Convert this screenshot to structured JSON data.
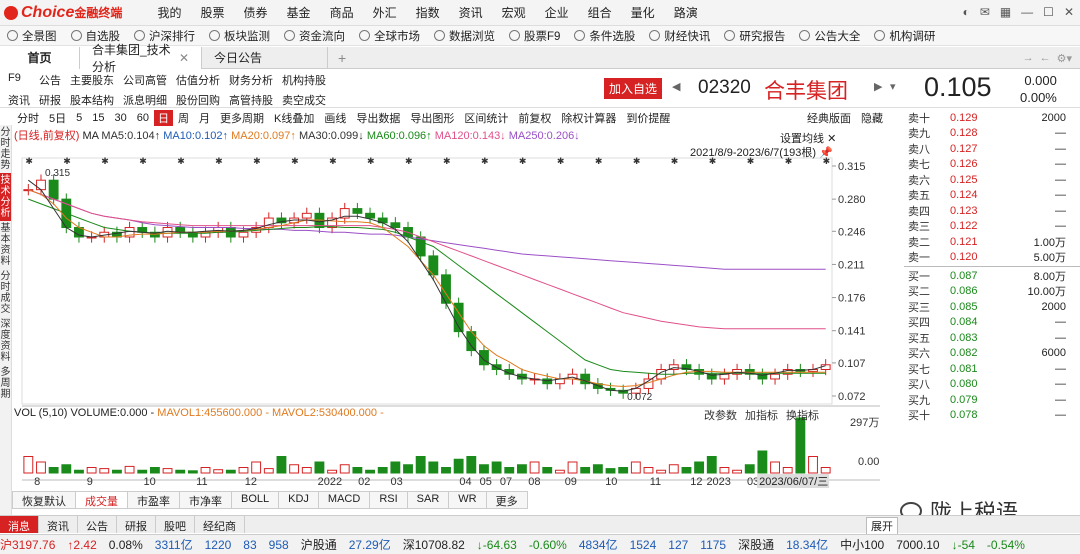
{
  "app": {
    "brand": "Choice",
    "brand_sub": "金融终端"
  },
  "menu": [
    "我的",
    "股票",
    "债券",
    "基金",
    "商品",
    "外汇",
    "指数",
    "资讯",
    "宏观",
    "企业",
    "组合",
    "量化",
    "路演"
  ],
  "toolbar": [
    "全景图",
    "自选股",
    "沪深排行",
    "板块监测",
    "资金流向",
    "全球市场",
    "数据浏览",
    "股票F9",
    "条件选股",
    "财经快讯",
    "研究报告",
    "公告大全",
    "机构调研"
  ],
  "tabs": {
    "home": "首页",
    "current": "合丰集团_技术分析",
    "other": "今日公告"
  },
  "funcs": [
    "F9",
    "公告",
    "主要股东",
    "公司高管",
    "估值分析",
    "财务分析",
    "机构持股",
    "资讯",
    "研报",
    "股本结构",
    "派息明细",
    "股份回购",
    "高管持股",
    "卖空成交"
  ],
  "stock": {
    "add_fav": "加入自选",
    "code": "02320",
    "name": "合丰集团",
    "price": "0.105",
    "change": "0.000",
    "change_pct": "0.00%"
  },
  "leftbar": [
    "分时走势",
    "技术分析",
    "基本资料",
    "分时成交",
    "深度资料",
    "多周期"
  ],
  "kbar": {
    "items": [
      "分时",
      "5日",
      "5",
      "15",
      "30",
      "60",
      "日",
      "周",
      "月",
      "更多周期",
      "K线叠加",
      "画线",
      "导出数据",
      "导出图形",
      "区间统计",
      "前复权",
      "除权计算器",
      "到价提醒"
    ],
    "active": "日",
    "right": [
      "经典版面",
      "隐藏"
    ]
  },
  "legend": {
    "mode": "(日线,前复权)",
    "ma5": "MA5:0.104↑",
    "ma10": "MA10:0.102↑",
    "ma20": "MA20:0.097↑",
    "ma30": "MA30:0.099↓",
    "ma60": "MA60:0.096↑",
    "ma120": "MA120:0.143↓",
    "ma250": "MA250:0.206↓"
  },
  "topright": {
    "setting": "设置均线",
    "range": "2021/8/9-2023/6/7(193根)"
  },
  "vol": {
    "legend": "VOL (5,10) VOLUME:0.000 -",
    "mavol1": "MAVOL1:455600.000 -",
    "mavol2": "MAVOL2:530400.000 -",
    "right": [
      "改参数",
      "加指标",
      "换指标"
    ]
  },
  "bottomtabs": [
    "恢复默认",
    "成交量",
    "市盈率",
    "市净率",
    "BOLL",
    "KDJ",
    "MACD",
    "RSI",
    "SAR",
    "WR",
    "更多"
  ],
  "bottom_active": "成交量",
  "infotabs": [
    "消息",
    "资讯",
    "公告",
    "研报",
    "股吧",
    "经纪商"
  ],
  "expand": "展开",
  "status": [
    "沪3197.76",
    "↑2.42",
    "0.08%",
    "3311亿",
    "1220",
    "83",
    "958",
    "沪股通",
    "27.29亿",
    "深10708.82",
    "↓-64.63",
    "-0.60%",
    "4834亿",
    "1524",
    "127",
    "1175",
    "深股通",
    "18.34亿",
    "中小100",
    "7000.10",
    "↓-54",
    "-0.54%"
  ],
  "orderbook": {
    "sell": [
      [
        "卖十",
        "0.129",
        "2000"
      ],
      [
        "卖九",
        "0.128",
        "—"
      ],
      [
        "卖八",
        "0.127",
        "—"
      ],
      [
        "卖七",
        "0.126",
        "—"
      ],
      [
        "卖六",
        "0.125",
        "—"
      ],
      [
        "卖五",
        "0.124",
        "—"
      ],
      [
        "卖四",
        "0.123",
        "—"
      ],
      [
        "卖三",
        "0.122",
        "—"
      ],
      [
        "卖二",
        "0.121",
        "1.00万"
      ],
      [
        "卖一",
        "0.120",
        "5.00万"
      ]
    ],
    "buy": [
      [
        "买一",
        "0.087",
        "8.00万"
      ],
      [
        "买二",
        "0.086",
        "10.00万"
      ],
      [
        "买三",
        "0.085",
        "2000"
      ],
      [
        "买四",
        "0.084",
        "—"
      ],
      [
        "买五",
        "0.083",
        "—"
      ],
      [
        "买六",
        "0.082",
        "6000"
      ],
      [
        "买七",
        "0.081",
        "—"
      ],
      [
        "买八",
        "0.080",
        "—"
      ],
      [
        "买九",
        "0.079",
        "—"
      ],
      [
        "买十",
        "0.078",
        "—"
      ]
    ]
  },
  "watermark": "陇上税语",
  "chart_data": {
    "type": "candlestick",
    "yticks": [
      "0.315",
      "0.280",
      "0.246",
      "0.211",
      "0.176",
      "0.141",
      "0.107",
      "0.072"
    ],
    "ymin": 0.072,
    "ymax": 0.315,
    "xticks": [
      "8",
      "9",
      "10",
      "11",
      "12",
      "2022",
      "02",
      "03",
      "04",
      "05",
      "07",
      "08",
      "09",
      "10",
      "11",
      "12",
      "2023",
      "03",
      "2023/06/07/三"
    ],
    "annotations": {
      "high": "0.315",
      "low": "0.072"
    },
    "volume_ticks": [
      "297万",
      "0.00"
    ],
    "close": [
      0.29,
      0.3,
      0.28,
      0.25,
      0.24,
      0.24,
      0.245,
      0.24,
      0.25,
      0.245,
      0.24,
      0.25,
      0.245,
      0.24,
      0.245,
      0.25,
      0.24,
      0.245,
      0.25,
      0.26,
      0.255,
      0.26,
      0.265,
      0.25,
      0.26,
      0.27,
      0.265,
      0.26,
      0.255,
      0.25,
      0.24,
      0.22,
      0.2,
      0.17,
      0.14,
      0.12,
      0.105,
      0.1,
      0.095,
      0.09,
      0.09,
      0.085,
      0.09,
      0.095,
      0.085,
      0.08,
      0.078,
      0.075,
      0.08,
      0.09,
      0.1,
      0.105,
      0.1,
      0.095,
      0.09,
      0.095,
      0.1,
      0.095,
      0.09,
      0.095,
      0.1,
      0.098,
      0.1,
      0.105
    ],
    "ma250": [
      0.29,
      0.285,
      0.28,
      0.275,
      0.27,
      0.265,
      0.262,
      0.26,
      0.258,
      0.255,
      0.253,
      0.252,
      0.251,
      0.25,
      0.25,
      0.25,
      0.25,
      0.249,
      0.249,
      0.248,
      0.248,
      0.247,
      0.247,
      0.246,
      0.245,
      0.245,
      0.244,
      0.243,
      0.243,
      0.242,
      0.24,
      0.238,
      0.236,
      0.234,
      0.232,
      0.23,
      0.228,
      0.226,
      0.224,
      0.222,
      0.221,
      0.22,
      0.219,
      0.218,
      0.217,
      0.216,
      0.215,
      0.214,
      0.213,
      0.212,
      0.211,
      0.21,
      0.209,
      0.208,
      0.207,
      0.206,
      0.206,
      0.206,
      0.206,
      0.206,
      0.206,
      0.206,
      0.206,
      0.206
    ],
    "ma120": [
      0.29,
      0.285,
      0.28,
      0.275,
      0.27,
      0.265,
      0.262,
      0.26,
      0.258,
      0.256,
      0.255,
      0.254,
      0.253,
      0.252,
      0.252,
      0.252,
      0.252,
      0.252,
      0.252,
      0.252,
      0.252,
      0.252,
      0.252,
      0.252,
      0.252,
      0.252,
      0.252,
      0.252,
      0.25,
      0.248,
      0.245,
      0.24,
      0.235,
      0.23,
      0.225,
      0.22,
      0.215,
      0.21,
      0.205,
      0.2,
      0.195,
      0.19,
      0.185,
      0.18,
      0.175,
      0.17,
      0.165,
      0.16,
      0.157,
      0.154,
      0.151,
      0.149,
      0.147,
      0.145,
      0.144,
      0.143,
      0.143,
      0.143,
      0.143,
      0.143,
      0.143,
      0.143,
      0.143,
      0.143
    ],
    "ma60": [
      0.28,
      0.275,
      0.27,
      0.265,
      0.26,
      0.255,
      0.25,
      0.248,
      0.246,
      0.245,
      0.244,
      0.244,
      0.244,
      0.244,
      0.244,
      0.245,
      0.245,
      0.246,
      0.247,
      0.248,
      0.249,
      0.25,
      0.25,
      0.251,
      0.251,
      0.25,
      0.25,
      0.249,
      0.248,
      0.245,
      0.24,
      0.235,
      0.23,
      0.22,
      0.21,
      0.2,
      0.19,
      0.18,
      0.17,
      0.16,
      0.15,
      0.14,
      0.13,
      0.12,
      0.11,
      0.105,
      0.1,
      0.098,
      0.097,
      0.096,
      0.095,
      0.095,
      0.096,
      0.096,
      0.096,
      0.096,
      0.096,
      0.096,
      0.096,
      0.096,
      0.096,
      0.096,
      0.096,
      0.096
    ],
    "ma20": [
      0.29,
      0.285,
      0.275,
      0.26,
      0.25,
      0.245,
      0.24,
      0.24,
      0.242,
      0.243,
      0.243,
      0.244,
      0.245,
      0.245,
      0.245,
      0.246,
      0.246,
      0.247,
      0.248,
      0.25,
      0.252,
      0.255,
      0.258,
      0.258,
      0.257,
      0.256,
      0.256,
      0.255,
      0.25,
      0.24,
      0.23,
      0.215,
      0.2,
      0.18,
      0.16,
      0.14,
      0.125,
      0.115,
      0.108,
      0.1,
      0.096,
      0.093,
      0.09,
      0.09,
      0.088,
      0.085,
      0.083,
      0.082,
      0.083,
      0.086,
      0.09,
      0.094,
      0.097,
      0.098,
      0.098,
      0.097,
      0.097,
      0.097,
      0.097,
      0.097,
      0.097,
      0.097,
      0.097,
      0.097
    ],
    "ma5": [
      0.3,
      0.29,
      0.27,
      0.25,
      0.242,
      0.24,
      0.242,
      0.244,
      0.246,
      0.245,
      0.244,
      0.246,
      0.245,
      0.245,
      0.246,
      0.247,
      0.246,
      0.247,
      0.249,
      0.253,
      0.256,
      0.258,
      0.258,
      0.256,
      0.258,
      0.262,
      0.262,
      0.259,
      0.255,
      0.248,
      0.235,
      0.215,
      0.195,
      0.17,
      0.145,
      0.125,
      0.11,
      0.102,
      0.096,
      0.092,
      0.09,
      0.088,
      0.09,
      0.092,
      0.088,
      0.083,
      0.078,
      0.077,
      0.08,
      0.088,
      0.097,
      0.102,
      0.101,
      0.098,
      0.094,
      0.095,
      0.097,
      0.096,
      0.094,
      0.096,
      0.099,
      0.099,
      0.1,
      0.104
    ],
    "volume": [
      0.3,
      0.2,
      0.1,
      0.15,
      0.05,
      0.1,
      0.08,
      0.05,
      0.12,
      0.05,
      0.1,
      0.08,
      0.05,
      0.04,
      0.1,
      0.06,
      0.05,
      0.1,
      0.2,
      0.08,
      0.3,
      0.15,
      0.1,
      0.2,
      0.05,
      0.15,
      0.1,
      0.05,
      0.1,
      0.2,
      0.15,
      0.3,
      0.2,
      0.1,
      0.25,
      0.3,
      0.15,
      0.2,
      0.1,
      0.15,
      0.2,
      0.1,
      0.05,
      0.2,
      0.1,
      0.15,
      0.08,
      0.1,
      0.2,
      0.1,
      0.05,
      0.15,
      0.1,
      0.2,
      0.3,
      0.1,
      0.05,
      0.15,
      0.4,
      0.2,
      0.1,
      1.0,
      0.3,
      0.1
    ]
  }
}
